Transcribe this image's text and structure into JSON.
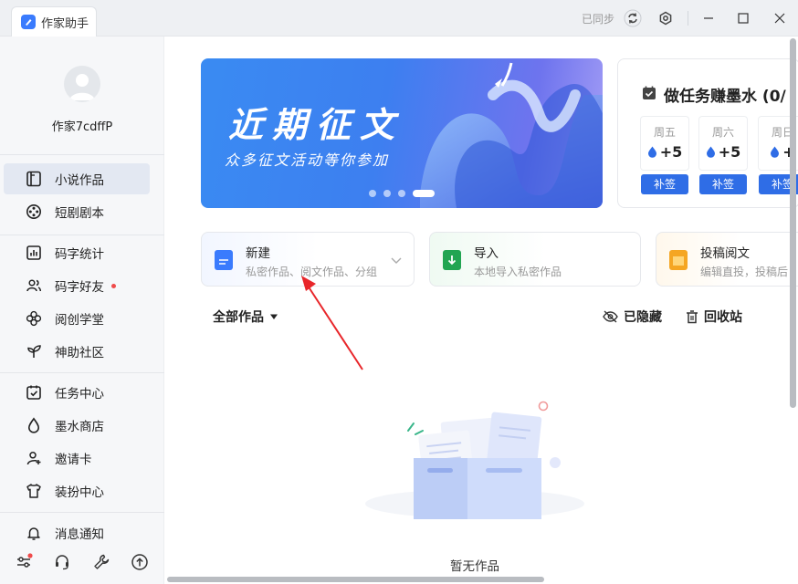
{
  "window": {
    "tab_title": "作家助手",
    "sync_status": "已同步"
  },
  "user": {
    "name": "作家7cdffP"
  },
  "nav": {
    "items": [
      {
        "label": "小说作品"
      },
      {
        "label": "短剧剧本"
      },
      {
        "label": "码字统计"
      },
      {
        "label": "码字好友"
      },
      {
        "label": "阅创学堂"
      },
      {
        "label": "神助社区"
      },
      {
        "label": "任务中心"
      },
      {
        "label": "墨水商店"
      },
      {
        "label": "邀请卡"
      },
      {
        "label": "装扮中心"
      },
      {
        "label": "消息通知"
      }
    ]
  },
  "banner": {
    "title": "近期征文",
    "subtitle": "众多征文活动等你参加"
  },
  "tasks": {
    "title": "做任务赚墨水 (0/",
    "days": [
      {
        "name": "周五",
        "value": "+5",
        "button": "补签"
      },
      {
        "name": "周六",
        "value": "+5",
        "button": "补签"
      },
      {
        "name": "周日",
        "value": "+",
        "button": "补签"
      }
    ]
  },
  "quick_actions": [
    {
      "title": "新建",
      "subtitle": "私密作品、阅文作品、分组"
    },
    {
      "title": "导入",
      "subtitle": "本地导入私密作品"
    },
    {
      "title": "投稿阅文",
      "subtitle": "编辑直投，投稿后"
    }
  ],
  "works": {
    "filter_label": "全部作品",
    "hidden_label": "已隐藏",
    "recycle_label": "回收站",
    "empty_text": "暂无作品"
  },
  "colors": {
    "accent": "#2f6de6",
    "nav_active_bg": "#e3e8f2",
    "annotation_arrow": "#e8262a"
  }
}
